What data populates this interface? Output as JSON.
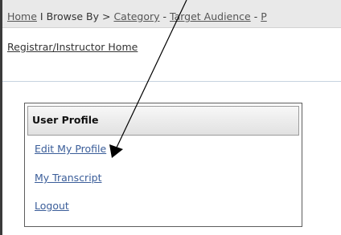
{
  "breadcrumb": {
    "home": "Home",
    "separator": " I ",
    "browse_by": "Browse By > ",
    "category": "Category",
    "dash1": " - ",
    "target_audience": "Target Audience",
    "dash2": " - ",
    "truncated": "P"
  },
  "subnav": {
    "registrar_home": "Registrar/Instructor Home"
  },
  "user_profile": {
    "title": "User Profile",
    "links": [
      {
        "label": "Edit My Profile"
      },
      {
        "label": "My Transcript"
      },
      {
        "label": "Logout"
      }
    ]
  },
  "colors": {
    "link": "#3a5d99",
    "nav_bg": "#e9e9e9",
    "divider": "#c6d3df"
  }
}
